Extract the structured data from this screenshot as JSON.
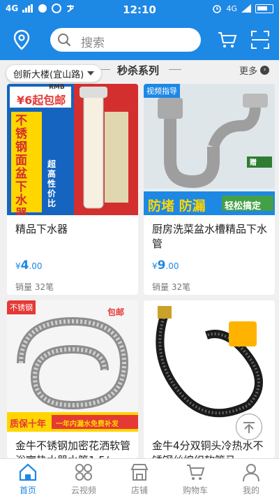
{
  "status_bar": {
    "carrier_left": "4G",
    "time": "12:10",
    "network_right": "4G"
  },
  "header": {
    "search_placeholder": "搜索"
  },
  "location_chip": {
    "label": "创新大楼(宜山路)"
  },
  "section": {
    "title": "秒杀系列",
    "more_label": "更多"
  },
  "products": [
    {
      "name": "精品下水器",
      "currency": "¥",
      "price": "4",
      "decimals": ".00",
      "sales": "销量 32笔",
      "banner": {
        "top_line": "¥6起包邮",
        "rmb": "RMB",
        "vertical_text": "不锈钢面盆下水器",
        "side_text": "超高性价比"
      }
    },
    {
      "name": "厨房洗菜盆水槽精品下水管",
      "currency": "¥",
      "price": "9",
      "decimals": ".00",
      "sales": "销量 32笔",
      "banner": {
        "tag": "视频指导",
        "bottom_text": "防堵 防漏",
        "bottom_right": "轻松搞定",
        "small_tag": "赠"
      }
    },
    {
      "name": "金牛不锈钢加密花洒软管浴室热水器水管1.5/...",
      "currency": "¥",
      "price": "",
      "decimals": "",
      "sales": "",
      "banner": {
        "tag": "不锈钢",
        "corner": "包邮",
        "bottom_left": "质保十年",
        "bottom_right": "一年内漏水免费补发"
      }
    },
    {
      "name": "金牛4分双铜头冷热水不锈钢丝编织软管马...",
      "currency": "¥",
      "price": "",
      "decimals": "",
      "sales": "",
      "banner": {}
    }
  ],
  "tabs": [
    {
      "label": "首页",
      "icon": "home-icon",
      "active": true
    },
    {
      "label": "云视频",
      "icon": "video-grid-icon",
      "active": false
    },
    {
      "label": "店铺",
      "icon": "store-icon",
      "active": false
    },
    {
      "label": "购物车",
      "icon": "cart-icon",
      "active": false
    },
    {
      "label": "我的",
      "icon": "user-icon",
      "active": false
    }
  ],
  "colors": {
    "primary": "#1e88e5",
    "promo_red": "#e53935",
    "promo_yellow": "#ffd600"
  }
}
